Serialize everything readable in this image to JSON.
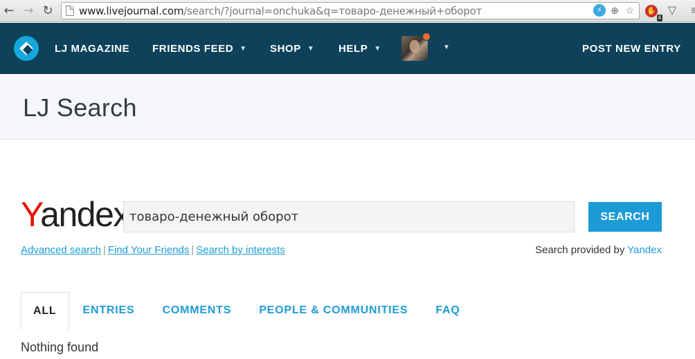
{
  "browser": {
    "url_host": "www.livejournal.com",
    "url_rest": "/search/?journal=onchuka&q=товаро-денежный+оборот",
    "adblock_count": "4"
  },
  "header": {
    "nav": [
      {
        "label": "LJ MAGAZINE",
        "has_caret": false
      },
      {
        "label": "FRIENDS FEED",
        "has_caret": true
      },
      {
        "label": "SHOP",
        "has_caret": true
      },
      {
        "label": "HELP",
        "has_caret": true
      }
    ],
    "post_label": "POST NEW ENTRY"
  },
  "page": {
    "title": "LJ Search"
  },
  "search": {
    "logo_first": "Y",
    "logo_rest": "andex",
    "query": "товаро-денежный оборот",
    "button_label": "SEARCH",
    "links": [
      "Advanced search",
      "Find Your Friends",
      "Search by interests"
    ],
    "provided_prefix": "Search provided by",
    "provided_link": "Yandex"
  },
  "tabs": [
    "ALL",
    "ENTRIES",
    "COMMENTS",
    "PEOPLE & COMMUNITIES",
    "FAQ"
  ],
  "result": "Nothing found"
}
